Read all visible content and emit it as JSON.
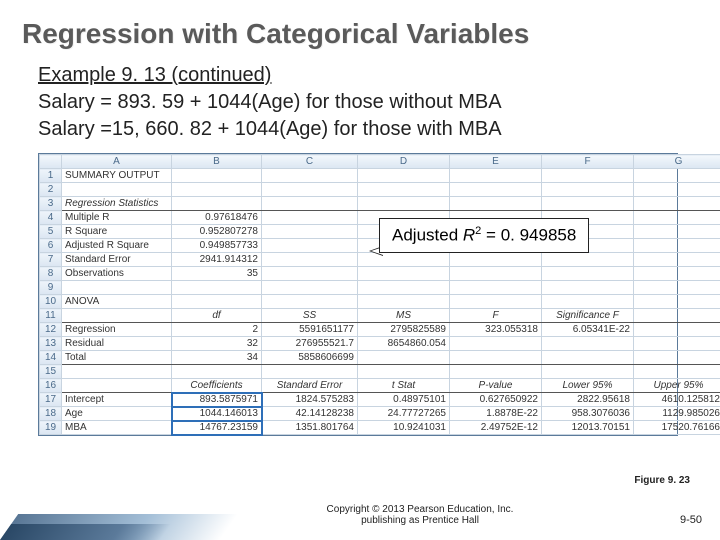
{
  "title": "Regression with Categorical Variables",
  "example_heading": "Example 9. 13 (continued)",
  "eq1": "Salary = 893. 59 + 1044(Age) for those without MBA",
  "eq2": "Salary =15, 660. 82 + 1044(Age) for those with MBA",
  "callout_prefix": "Adjusted ",
  "callout_var": "R",
  "callout_rest": " = 0. 949858",
  "fig_caption": "Figure 9. 23",
  "copyright_line1": "Copyright © 2013 Pearson Education, Inc.",
  "copyright_line2": "publishing as Prentice Hall",
  "slide_number": "9-50",
  "excel": {
    "cols": [
      "A",
      "B",
      "C",
      "D",
      "E",
      "F",
      "G"
    ],
    "rows": [
      {
        "n": "1",
        "A": "SUMMARY OUTPUT"
      },
      {
        "n": "2"
      },
      {
        "n": "3",
        "A": "Regression Statistics",
        "italicA": true,
        "underline": true
      },
      {
        "n": "4",
        "A": "Multiple R",
        "B": "0.97618476"
      },
      {
        "n": "5",
        "A": "R Square",
        "B": "0.952807278"
      },
      {
        "n": "6",
        "A": "Adjusted R Square",
        "B": "0.949857733"
      },
      {
        "n": "7",
        "A": "Standard Error",
        "B": "2941.914312"
      },
      {
        "n": "8",
        "A": "Observations",
        "B": "35"
      },
      {
        "n": "9"
      },
      {
        "n": "10",
        "A": "ANOVA"
      },
      {
        "n": "11",
        "B": "df",
        "C": "SS",
        "D": "MS",
        "E": "F",
        "F": "Significance F",
        "italicRow": true,
        "centerRow": true,
        "underline": true
      },
      {
        "n": "12",
        "A": "Regression",
        "B": "2",
        "C": "5591651177",
        "D": "2795825589",
        "E": "323.055318",
        "F": "6.05341E-22"
      },
      {
        "n": "13",
        "A": "Residual",
        "B": "32",
        "C": "276955521.7",
        "D": "8654860.054"
      },
      {
        "n": "14",
        "A": "Total",
        "B": "34",
        "C": "5858606699",
        "underline": true
      },
      {
        "n": "15"
      },
      {
        "n": "16",
        "B": "Coefficients",
        "C": "Standard Error",
        "D": "t Stat",
        "E": "P-value",
        "F": "Lower 95%",
        "G": "Upper 95%",
        "italicRow": true,
        "centerRow": true,
        "underline": true
      },
      {
        "n": "17",
        "A": "Intercept",
        "B": "893.5875971",
        "C": "1824.575283",
        "D": "0.48975101",
        "E": "0.627650922",
        "F": "2822.95618",
        "G": "4610.125812",
        "selB": true
      },
      {
        "n": "18",
        "A": "Age",
        "B": "1044.146013",
        "C": "42.14128238",
        "D": "24.77727265",
        "E": "1.8878E-22",
        "F": "958.3076036",
        "G": "1129.985026",
        "selB": true
      },
      {
        "n": "19",
        "A": "MBA",
        "B": "14767.23159",
        "C": "1351.801764",
        "D": "10.9241031",
        "E": "2.49752E-12",
        "F": "12013.70151",
        "G": "17520.76166",
        "selB": true
      }
    ]
  }
}
